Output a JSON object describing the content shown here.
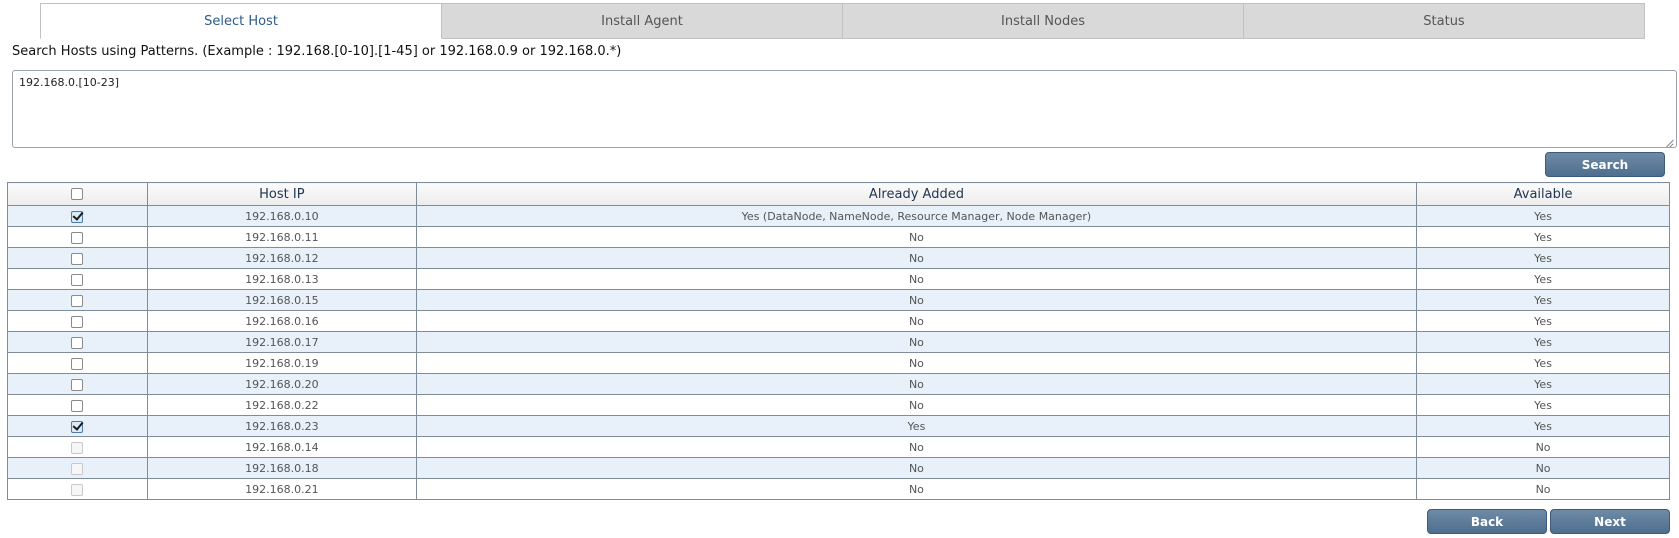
{
  "tabs": [
    {
      "label": "Select Host",
      "active": true
    },
    {
      "label": "Install Agent",
      "active": false
    },
    {
      "label": "Install Nodes",
      "active": false
    },
    {
      "label": "Status",
      "active": false
    }
  ],
  "search": {
    "hint": "Search Hosts using Patterns. (Example : 192.168.[0-10].[1-45] or 192.168.0.9 or 192.168.0.*)",
    "pattern_value": "192.168.0.[10-23]",
    "button_label": "Search"
  },
  "table": {
    "headers": {
      "ip": "Host IP",
      "added": "Already Added",
      "available": "Available"
    },
    "select_all_checked": false,
    "rows": [
      {
        "ip": "192.168.0.10",
        "added": "Yes (DataNode, NameNode, Resource Manager, Node Manager)",
        "available": "Yes",
        "checked": true,
        "disabled": false
      },
      {
        "ip": "192.168.0.11",
        "added": "No",
        "available": "Yes",
        "checked": false,
        "disabled": false
      },
      {
        "ip": "192.168.0.12",
        "added": "No",
        "available": "Yes",
        "checked": false,
        "disabled": false
      },
      {
        "ip": "192.168.0.13",
        "added": "No",
        "available": "Yes",
        "checked": false,
        "disabled": false
      },
      {
        "ip": "192.168.0.15",
        "added": "No",
        "available": "Yes",
        "checked": false,
        "disabled": false
      },
      {
        "ip": "192.168.0.16",
        "added": "No",
        "available": "Yes",
        "checked": false,
        "disabled": false
      },
      {
        "ip": "192.168.0.17",
        "added": "No",
        "available": "Yes",
        "checked": false,
        "disabled": false
      },
      {
        "ip": "192.168.0.19",
        "added": "No",
        "available": "Yes",
        "checked": false,
        "disabled": false
      },
      {
        "ip": "192.168.0.20",
        "added": "No",
        "available": "Yes",
        "checked": false,
        "disabled": false
      },
      {
        "ip": "192.168.0.22",
        "added": "No",
        "available": "Yes",
        "checked": false,
        "disabled": false
      },
      {
        "ip": "192.168.0.23",
        "added": "Yes",
        "available": "Yes",
        "checked": true,
        "disabled": false
      },
      {
        "ip": "192.168.0.14",
        "added": "No",
        "available": "No",
        "checked": false,
        "disabled": true
      },
      {
        "ip": "192.168.0.18",
        "added": "No",
        "available": "No",
        "checked": false,
        "disabled": true
      },
      {
        "ip": "192.168.0.21",
        "added": "No",
        "available": "No",
        "checked": false,
        "disabled": true
      }
    ]
  },
  "footer": {
    "back_label": "Back",
    "next_label": "Next"
  }
}
